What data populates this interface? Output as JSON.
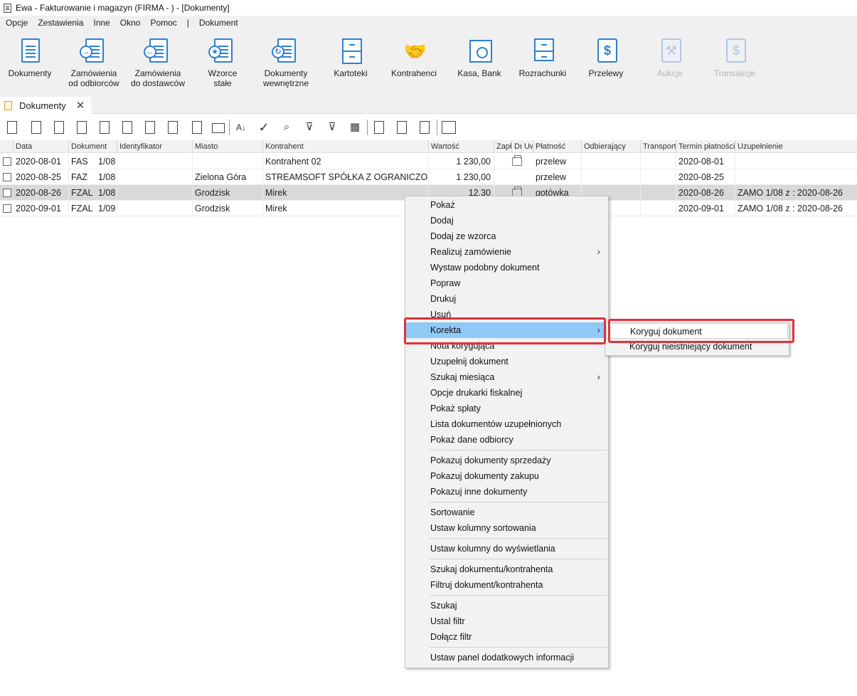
{
  "window": {
    "title": "Ewa - Fakturowanie i magazyn (FIRMA - ) - [Dokumenty]"
  },
  "menubar": {
    "items": [
      {
        "label": "Opcje"
      },
      {
        "label": "Zestawienia"
      },
      {
        "label": "Inne"
      },
      {
        "label": "Okno"
      },
      {
        "label": "Pomoc"
      },
      {
        "label": "|"
      },
      {
        "label": "Dokument"
      }
    ]
  },
  "ribbon": {
    "buttons": [
      {
        "label1": "Dokumenty",
        "label2": "",
        "icon": "document-icon",
        "enabled": true
      },
      {
        "label1": "Zamówienia",
        "label2": "od odbiorców",
        "icon": "order-in-icon",
        "enabled": true
      },
      {
        "label1": "Zamówienia",
        "label2": "do dostawców",
        "icon": "order-out-icon",
        "enabled": true
      },
      {
        "label1": "Wzorce",
        "label2": "stałe",
        "icon": "template-icon",
        "enabled": true
      },
      {
        "label1": "Dokumenty",
        "label2": "wewnętrzne",
        "icon": "internal-doc-icon",
        "enabled": true
      },
      {
        "label1": "Kartoteki",
        "label2": "",
        "icon": "cabinet-icon",
        "enabled": true
      },
      {
        "label1": "Kontrahenci",
        "label2": "",
        "icon": "handshake-icon",
        "enabled": true
      },
      {
        "label1": "Kasa, Bank",
        "label2": "",
        "icon": "safe-icon",
        "enabled": true
      },
      {
        "label1": "Rozrachunki",
        "label2": "",
        "icon": "settlements-icon",
        "enabled": true
      },
      {
        "label1": "Przelewy",
        "label2": "",
        "icon": "transfer-icon",
        "enabled": true
      },
      {
        "label1": "Aukcje",
        "label2": "",
        "icon": "gavel-icon",
        "enabled": false
      },
      {
        "label1": "Transakcje",
        "label2": "",
        "icon": "transactions-icon",
        "enabled": false
      }
    ]
  },
  "tab": {
    "label": "Dokumenty",
    "close": "✕"
  },
  "table": {
    "headers": [
      "Data",
      "Dokument",
      "Identyfikator",
      "Miasto",
      "Kontrahent",
      "Wartość",
      "Zapł",
      "Dr",
      "Uw",
      "Płatność",
      "Odbierający",
      "Transport",
      "Termin płatności",
      "Uzupełnienie"
    ],
    "rows": [
      {
        "data": "2020-08-01",
        "typ": "FAS",
        "nr": "1/08",
        "ident": "",
        "miasto": "",
        "kontrahent": "Kontrahent 02",
        "wartosc": "1 230,00",
        "printer": true,
        "platnosc": "przelew",
        "odbier": "",
        "transport": "",
        "termin": "2020-08-01",
        "uzup": ""
      },
      {
        "data": "2020-08-25",
        "typ": "FAZ",
        "nr": "1/08",
        "ident": "",
        "miasto": "Zielona Góra",
        "kontrahent": "STREAMSOFT SPÓŁKA Z OGRANICZONĄ",
        "wartosc": "1 230,00",
        "printer": false,
        "platnosc": "przelew",
        "odbier": "",
        "transport": "",
        "termin": "2020-08-25",
        "uzup": ""
      },
      {
        "data": "2020-08-26",
        "typ": "FZAL",
        "nr": "1/08",
        "ident": "",
        "miasto": "Grodzisk",
        "kontrahent": "Mirek",
        "wartosc": "12,30",
        "printer": true,
        "platnosc": "gotówka",
        "odbier": "",
        "transport": "",
        "termin": "2020-08-26",
        "uzup": "ZAMO 1/08 z : 2020-08-26"
      },
      {
        "data": "2020-09-01",
        "typ": "FZAL",
        "nr": "1/09",
        "ident": "",
        "miasto": "Grodzisk",
        "kontrahent": "Mirek",
        "wartosc": "",
        "printer": false,
        "platnosc": "",
        "odbier": "",
        "transport": "",
        "termin": "2020-09-01",
        "uzup": "ZAMO 1/08 z : 2020-08-26"
      }
    ]
  },
  "context_menu": {
    "items": [
      {
        "label": "Pokaż"
      },
      {
        "label": "Dodaj"
      },
      {
        "label": "Dodaj ze wzorca"
      },
      {
        "label": "Realizuj zamówienie",
        "submenu": true
      },
      {
        "label": "Wystaw podobny dokument"
      },
      {
        "label": "Popraw"
      },
      {
        "label": "Drukuj"
      },
      {
        "label": "Usuń"
      },
      {
        "label": "Korekta",
        "submenu": true,
        "highlighted": true
      },
      {
        "label": "Nota korygująca"
      },
      {
        "label": "Uzupełnij dokument"
      },
      {
        "label": "Szukaj miesiąca",
        "submenu": true
      },
      {
        "label": "Opcje drukarki fiskalnej"
      },
      {
        "label": "Pokaż spłaty"
      },
      {
        "label": "Lista dokumentów uzupełnionych"
      },
      {
        "label": "Pokaż dane odbiorcy"
      },
      {
        "label": "Pokazuj dokumenty sprzedaży"
      },
      {
        "label": "Pokazuj dokumenty zakupu"
      },
      {
        "label": "Pokazuj inne dokumenty"
      },
      {
        "label": "Sortowanie"
      },
      {
        "label": "Ustaw kolumny sortowania"
      },
      {
        "label": "Ustaw kolumny do wyświetlania"
      },
      {
        "label": "Szukaj dokumentu/kontrahenta"
      },
      {
        "label": "Filtruj dokument/kontrahenta"
      },
      {
        "label": "Szukaj"
      },
      {
        "label": "Ustal filtr"
      },
      {
        "label": "Dołącz filtr"
      },
      {
        "label": "Ustaw panel dodatkowych informacji"
      }
    ],
    "arrow": "›"
  },
  "submenu": {
    "items": [
      {
        "label": "Koryguj dokument",
        "highlighted": true
      },
      {
        "label": "Koryguj nieistniejący dokument"
      }
    ]
  },
  "colors": {
    "accent": "#2d7fd3",
    "highlight": "#91c9f7",
    "annotation": "#e0323a"
  }
}
